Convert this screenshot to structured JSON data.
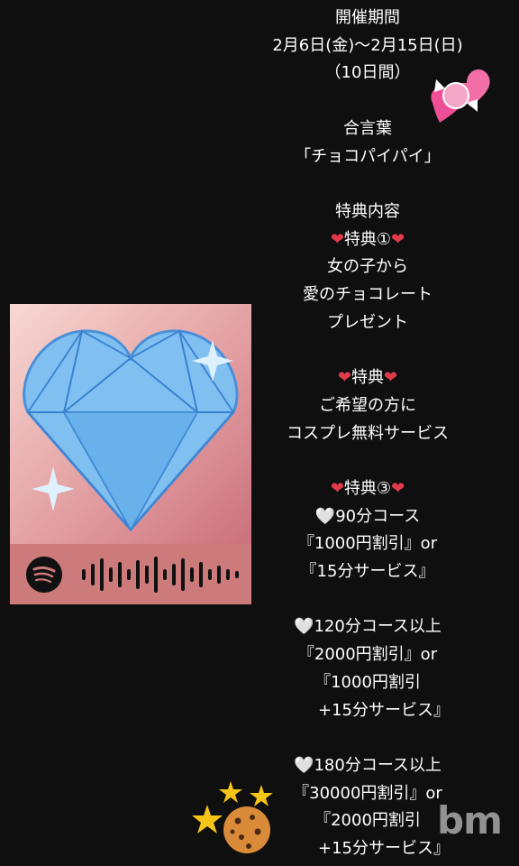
{
  "period": {
    "heading": "開催期間",
    "dates": "2月6日(金)～2月15日(日)",
    "duration": "（10日間）"
  },
  "password": {
    "heading": "合言葉",
    "value": "「チョコパイパイ」"
  },
  "benefits": {
    "heading": "特典内容",
    "b1": {
      "title": "特典①",
      "line1": "女の子から",
      "line2": "愛のチョコレート",
      "line3": "プレゼント"
    },
    "b2": {
      "title": "特典",
      "line1": "ご希望の方に",
      "line2": "コスプレ無料サービス"
    },
    "b3": {
      "title": "特典③",
      "c1_title": "90分コース",
      "c1_l1": "『1000円割引』or",
      "c1_l2": "『15分サービス』",
      "c2_title": "120分コース以上",
      "c2_l1": "『2000円割引』or",
      "c2_l2": "『1000円割引",
      "c2_l3": "　　+15分サービス』",
      "c3_title": "180分コース以上",
      "c3_l1": "『30000円割引』or",
      "c3_l2": "『2000円割引",
      "c3_l3": "　　+15分サービス』"
    }
  },
  "heart_symbol": "❤",
  "white_heart_symbol": "🤍",
  "watermark_text": "bm",
  "icons": {
    "candy": "heart-candy-icon",
    "cookie": "cookie-icon",
    "stars": "sparkle-stars-icon",
    "spotify": "spotify-icon"
  },
  "colors": {
    "background": "#0f0f0f",
    "text": "#ffffff",
    "red_heart": "#e23a4a",
    "album_bar": "#cc7a7a"
  }
}
